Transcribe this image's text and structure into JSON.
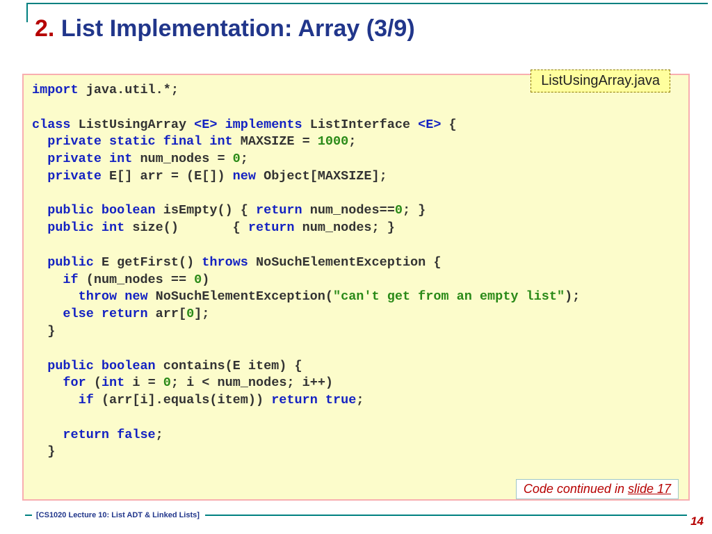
{
  "title": {
    "number": "2.",
    "text": "List Implementation: Array (3/9)"
  },
  "filename_badge": "ListUsingArray.java",
  "continued": {
    "prefix": "Code continued in ",
    "link": "slide 17"
  },
  "footer": "[CS1020 Lecture 10: List ADT & Linked Lists]",
  "page_number": "14",
  "code": {
    "tokens": [
      {
        "t": "import",
        "c": "kw"
      },
      {
        "t": " java.util.*;\n\n"
      },
      {
        "t": "class",
        "c": "kw"
      },
      {
        "t": " ListUsingArray "
      },
      {
        "t": "<E>",
        "c": "kw"
      },
      {
        "t": " "
      },
      {
        "t": "implements",
        "c": "kw"
      },
      {
        "t": " ListInterface "
      },
      {
        "t": "<E>",
        "c": "kw"
      },
      {
        "t": " {\n"
      },
      {
        "t": "  "
      },
      {
        "t": "private static final int",
        "c": "kw"
      },
      {
        "t": " MAXSIZE = "
      },
      {
        "t": "1000",
        "c": "lit"
      },
      {
        "t": ";\n"
      },
      {
        "t": "  "
      },
      {
        "t": "private int",
        "c": "kw"
      },
      {
        "t": " num_nodes = "
      },
      {
        "t": "0",
        "c": "lit"
      },
      {
        "t": ";\n"
      },
      {
        "t": "  "
      },
      {
        "t": "private",
        "c": "kw"
      },
      {
        "t": " E[] arr = (E[]) "
      },
      {
        "t": "new",
        "c": "kw"
      },
      {
        "t": " Object[MAXSIZE];\n\n"
      },
      {
        "t": "  "
      },
      {
        "t": "public boolean",
        "c": "kw"
      },
      {
        "t": " isEmpty() { "
      },
      {
        "t": "return",
        "c": "kw"
      },
      {
        "t": " num_nodes=="
      },
      {
        "t": "0",
        "c": "lit"
      },
      {
        "t": "; }\n"
      },
      {
        "t": "  "
      },
      {
        "t": "public int",
        "c": "kw"
      },
      {
        "t": " size()       { "
      },
      {
        "t": "return",
        "c": "kw"
      },
      {
        "t": " num_nodes; }\n\n"
      },
      {
        "t": "  "
      },
      {
        "t": "public",
        "c": "kw"
      },
      {
        "t": " E getFirst() "
      },
      {
        "t": "throws",
        "c": "kw"
      },
      {
        "t": " NoSuchElementException {\n"
      },
      {
        "t": "    "
      },
      {
        "t": "if",
        "c": "kw"
      },
      {
        "t": " (num_nodes == "
      },
      {
        "t": "0",
        "c": "lit"
      },
      {
        "t": ")\n"
      },
      {
        "t": "      "
      },
      {
        "t": "throw new",
        "c": "kw"
      },
      {
        "t": " NoSuchElementException("
      },
      {
        "t": "\"can't get from an empty list\"",
        "c": "lit"
      },
      {
        "t": ");\n"
      },
      {
        "t": "    "
      },
      {
        "t": "else return",
        "c": "kw"
      },
      {
        "t": " arr["
      },
      {
        "t": "0",
        "c": "lit"
      },
      {
        "t": "];\n"
      },
      {
        "t": "  }\n\n"
      },
      {
        "t": "  "
      },
      {
        "t": "public boolean",
        "c": "kw"
      },
      {
        "t": " contains(E item) {\n"
      },
      {
        "t": "    "
      },
      {
        "t": "for",
        "c": "kw"
      },
      {
        "t": " ("
      },
      {
        "t": "int",
        "c": "kw"
      },
      {
        "t": " i = "
      },
      {
        "t": "0",
        "c": "lit"
      },
      {
        "t": "; i < num_nodes; i++)\n"
      },
      {
        "t": "      "
      },
      {
        "t": "if",
        "c": "kw"
      },
      {
        "t": " (arr[i].equals(item)) "
      },
      {
        "t": "return true",
        "c": "kw"
      },
      {
        "t": ";\n\n"
      },
      {
        "t": "    "
      },
      {
        "t": "return false",
        "c": "kw"
      },
      {
        "t": ";\n"
      },
      {
        "t": "  }"
      }
    ]
  }
}
